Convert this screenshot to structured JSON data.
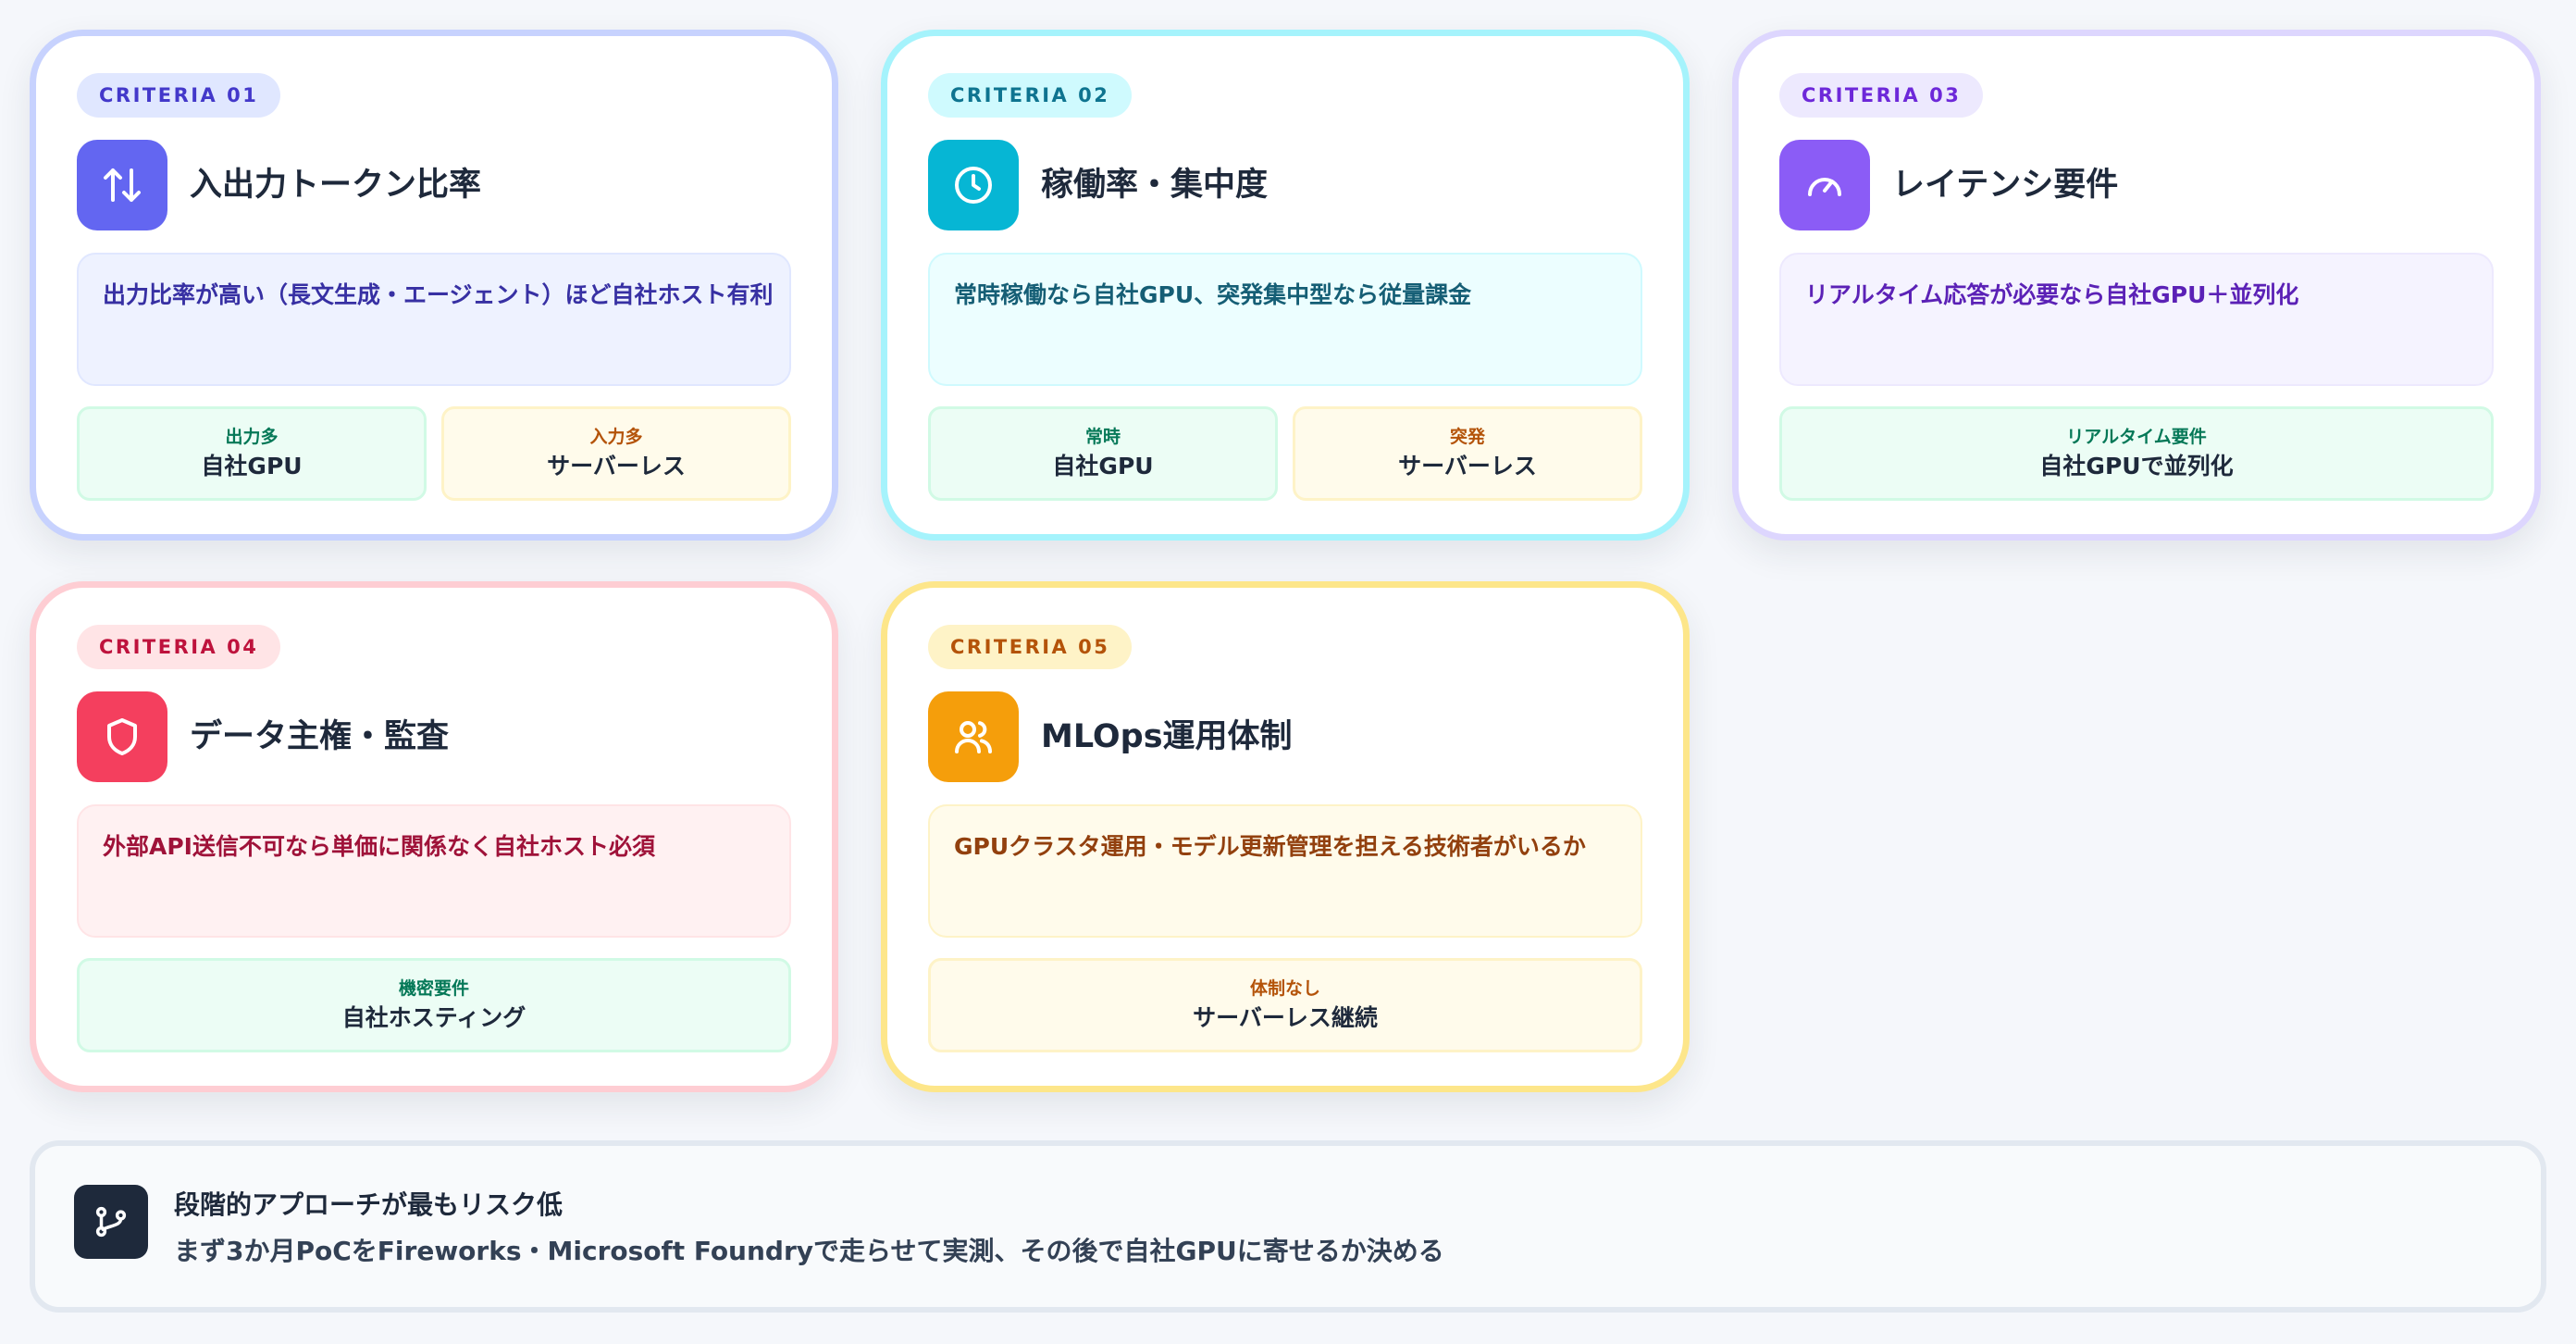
{
  "cards": [
    {
      "badge": "CRITERIA 01",
      "title": "入出力トークン比率",
      "icon": "arrows-up-down-icon",
      "description": "出力比率が高い（長文生成・エージェント）ほど自社ホスト有利",
      "options": [
        {
          "label": "出力多",
          "value": "自社GPU"
        },
        {
          "label": "入力多",
          "value": "サーバーレス"
        }
      ]
    },
    {
      "badge": "CRITERIA 02",
      "title": "稼働率・集中度",
      "icon": "clock-icon",
      "description": "常時稼働なら自社GPU、突発集中型なら従量課金",
      "options": [
        {
          "label": "常時",
          "value": "自社GPU"
        },
        {
          "label": "突発",
          "value": "サーバーレス"
        }
      ]
    },
    {
      "badge": "CRITERIA 03",
      "title": "レイテンシ要件",
      "icon": "gauge-icon",
      "description": "リアルタイム応答が必要なら自社GPU＋並列化",
      "options": [
        {
          "label": "リアルタイム要件",
          "value": "自社GPUで並列化"
        }
      ]
    },
    {
      "badge": "CRITERIA 04",
      "title": "データ主権・監査",
      "icon": "shield-icon",
      "description": "外部API送信不可なら単価に関係なく自社ホスト必須",
      "options": [
        {
          "label": "機密要件",
          "value": "自社ホスティング"
        }
      ]
    },
    {
      "badge": "CRITERIA 05",
      "title": "MLOps運用体制",
      "icon": "users-icon",
      "description": "GPUクラスタ運用・モデル更新管理を担える技術者がいるか",
      "options": [
        {
          "label": "体制なし",
          "value": "サーバーレス継続"
        }
      ]
    }
  ],
  "summary": {
    "icon": "git-branch-icon",
    "title": "段階的アプローチが最もリスク低",
    "text": "まず3か月PoCをFireworks・Microsoft Foundryで走らせて実測、その後で自社GPUに寄せるか決める"
  },
  "colors": {
    "indigo": "#6366f1",
    "cyan": "#06b6d4",
    "purple": "#8b5cf6",
    "rose": "#f43f5e",
    "amber": "#f59e0b"
  }
}
